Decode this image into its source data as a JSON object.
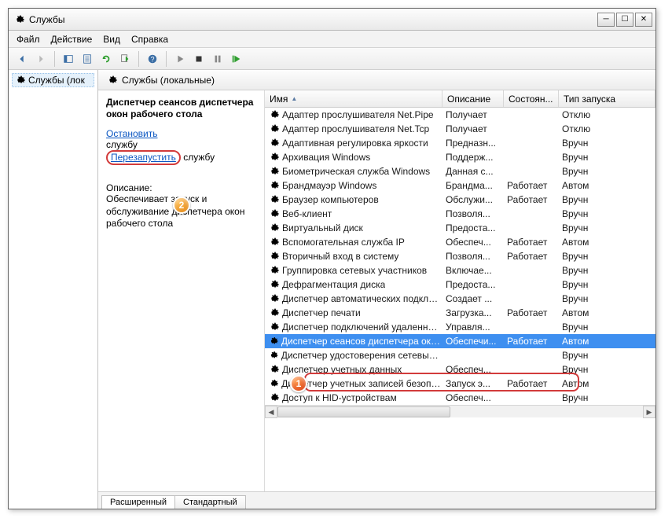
{
  "window": {
    "title": "Службы"
  },
  "menu": {
    "file": "Файл",
    "action": "Действие",
    "view": "Вид",
    "help": "Справка"
  },
  "leftTree": {
    "root": "Службы (лок"
  },
  "rightHead": "Службы (локальные)",
  "desc": {
    "service_name": "Диспетчер сеансов диспетчера окон рабочего стола",
    "stop_link": "Остановить",
    "stop_suffix": "службу",
    "restart_link": "Перезапустить",
    "restart_suffix": "службу",
    "label": "Описание:",
    "text": "Обеспечивает запуск и обслуживание диспетчера окон рабочего стола"
  },
  "cols": {
    "name": "Имя",
    "desc": "Описание",
    "state": "Состоян...",
    "start": "Тип запуска"
  },
  "tabs": {
    "extended": "Расширенный",
    "standard": "Стандартный"
  },
  "services": [
    {
      "name": "Адаптер прослушивателя Net.Pipe",
      "desc": "Получает",
      "state": "",
      "start": "Отклю"
    },
    {
      "name": "Адаптер прослушивателя Net.Tcp",
      "desc": "Получает",
      "state": "",
      "start": "Отклю"
    },
    {
      "name": "Адаптивная регулировка яркости",
      "desc": "Предназн...",
      "state": "",
      "start": "Вручн"
    },
    {
      "name": "Архивация Windows",
      "desc": "Поддерж...",
      "state": "",
      "start": "Вручн"
    },
    {
      "name": "Биометрическая служба Windows",
      "desc": "Данная с...",
      "state": "",
      "start": "Вручн"
    },
    {
      "name": "Брандмауэр Windows",
      "desc": "Брандма...",
      "state": "Работает",
      "start": "Автом"
    },
    {
      "name": "Браузер компьютеров",
      "desc": "Обслужи...",
      "state": "Работает",
      "start": "Вручн"
    },
    {
      "name": "Веб-клиент",
      "desc": "Позволя...",
      "state": "",
      "start": "Вручн"
    },
    {
      "name": "Виртуальный диск",
      "desc": "Предоста...",
      "state": "",
      "start": "Вручн"
    },
    {
      "name": "Вспомогательная служба IP",
      "desc": "Обеспеч...",
      "state": "Работает",
      "start": "Автом"
    },
    {
      "name": "Вторичный вход в систему",
      "desc": "Позволя...",
      "state": "Работает",
      "start": "Вручн"
    },
    {
      "name": "Группировка сетевых участников",
      "desc": "Включае...",
      "state": "",
      "start": "Вручн"
    },
    {
      "name": "Дефрагментация диска",
      "desc": "Предоста...",
      "state": "",
      "start": "Вручн"
    },
    {
      "name": "Диспетчер автоматических подклю...",
      "desc": "Создает ...",
      "state": "",
      "start": "Вручн"
    },
    {
      "name": "Диспетчер печати",
      "desc": "Загрузка...",
      "state": "Работает",
      "start": "Автом"
    },
    {
      "name": "Диспетчер подключений удаленног...",
      "desc": "Управля...",
      "state": "",
      "start": "Вручн"
    },
    {
      "name": "Диспетчер сеансов диспетчера окон р...",
      "desc": "Обеспечи...",
      "state": "Работает",
      "start": "Автом",
      "selected": true
    },
    {
      "name": "Диспетчер удостоверения сетевых уча...",
      "desc": "",
      "state": "",
      "start": "Вручн"
    },
    {
      "name": "Диспетчер учетных данных",
      "desc": "Обеспеч...",
      "state": "",
      "start": "Вручн"
    },
    {
      "name": "Диспетчер учетных записей безопасн...",
      "desc": "Запуск э...",
      "state": "Работает",
      "start": "Автом"
    },
    {
      "name": "Доступ к HID-устройствам",
      "desc": "Обеспеч...",
      "state": "",
      "start": "Вручн"
    }
  ]
}
